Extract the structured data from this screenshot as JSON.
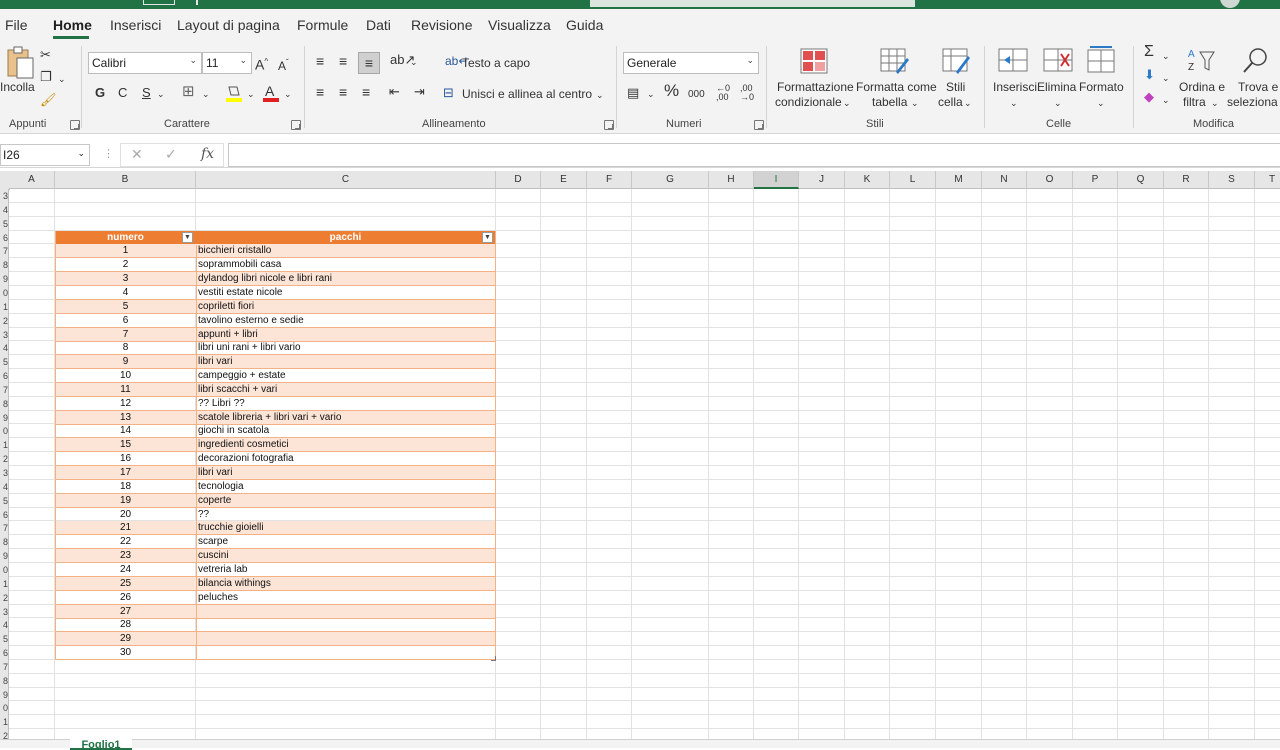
{
  "menu": {
    "tabs": [
      "File",
      "Home",
      "Inserisci",
      "Layout di pagina",
      "Formule",
      "Dati",
      "Revisione",
      "Visualizza",
      "Guida"
    ],
    "active": "Home"
  },
  "ribbon": {
    "clipboard": {
      "paste_label": "Incolla",
      "group_label": "Appunti"
    },
    "font": {
      "name": "Calibri",
      "size": "11",
      "bold": "G",
      "italic": "C",
      "underline": "S",
      "group_label": "Carattere"
    },
    "alignment": {
      "wrap_label": "Testo a capo",
      "merge_label": "Unisci e allinea al centro",
      "group_label": "Allineamento"
    },
    "number": {
      "format": "Generale",
      "thousands": "000",
      "group_label": "Numeri"
    },
    "styles": {
      "cond_format": [
        "Formattazione",
        "condizionale"
      ],
      "format_table": [
        "Formatta come",
        "tabella"
      ],
      "cell_styles": [
        "Stili",
        "cella"
      ],
      "group_label": "Stili"
    },
    "cells": {
      "insert": "Inserisci",
      "delete": "Elimina",
      "format": "Formato",
      "group_label": "Celle"
    },
    "editing": {
      "sort": [
        "Ordina e",
        "filtra"
      ],
      "find": [
        "Trova e",
        "seleziona"
      ],
      "group_label": "Modifica"
    }
  },
  "formula_bar": {
    "name_box": "I26",
    "fx": "fx",
    "content": ""
  },
  "columns": [
    "A",
    "B",
    "C",
    "D",
    "E",
    "F",
    "G",
    "H",
    "I",
    "J",
    "K",
    "L",
    "M",
    "N",
    "O",
    "P",
    "Q",
    "R",
    "S",
    "T"
  ],
  "selected_column": "I",
  "row_numbers": [
    "3",
    "4",
    "5",
    "6",
    "7",
    "8",
    "9",
    "0",
    "1",
    "2",
    "3",
    "4",
    "5",
    "6",
    "7",
    "8",
    "9",
    "0",
    "1",
    "2",
    "3",
    "4",
    "5",
    "6",
    "7",
    "8",
    "9",
    "0",
    "1",
    "2",
    "3",
    "4",
    "5",
    "6",
    "7",
    "8",
    "9",
    "0",
    "1",
    "2"
  ],
  "table": {
    "headers": [
      "numero",
      "pacchi"
    ],
    "rows": [
      [
        "1",
        "bicchieri cristallo"
      ],
      [
        "2",
        "soprammobili casa"
      ],
      [
        "3",
        "dylandog libri nicole e libri rani"
      ],
      [
        "4",
        "vestiti estate nicole"
      ],
      [
        "5",
        "copriletti fiori"
      ],
      [
        "6",
        "tavolino esterno e sedie"
      ],
      [
        "7",
        "appunti + libri"
      ],
      [
        "8",
        "libri uni rani + libri vario"
      ],
      [
        "9",
        "libri vari"
      ],
      [
        "10",
        "campeggio + estate"
      ],
      [
        "11",
        "libri scacchi + vari"
      ],
      [
        "12",
        "?? Libri ??"
      ],
      [
        "13",
        "scatole libreria + libri vari + vario"
      ],
      [
        "14",
        "giochi in scatola"
      ],
      [
        "15",
        "ingredienti cosmetici"
      ],
      [
        "16",
        "decorazioni fotografia"
      ],
      [
        "17",
        "libri vari"
      ],
      [
        "18",
        "tecnologia"
      ],
      [
        "19",
        "coperte"
      ],
      [
        "20",
        "??"
      ],
      [
        "21",
        "trucchie gioielli"
      ],
      [
        "22",
        "scarpe"
      ],
      [
        "23",
        "cuscini"
      ],
      [
        "24",
        "vetreria lab"
      ],
      [
        "25",
        "bilancia withings"
      ],
      [
        "26",
        "peluches"
      ],
      [
        "27",
        ""
      ],
      [
        "28",
        ""
      ],
      [
        "29",
        ""
      ],
      [
        "30",
        ""
      ]
    ]
  },
  "sheet": {
    "active_tab": "Foglio1"
  },
  "colors": {
    "accent": "#217346",
    "table_header": "#ed7d31",
    "band": "#fce4d6"
  }
}
